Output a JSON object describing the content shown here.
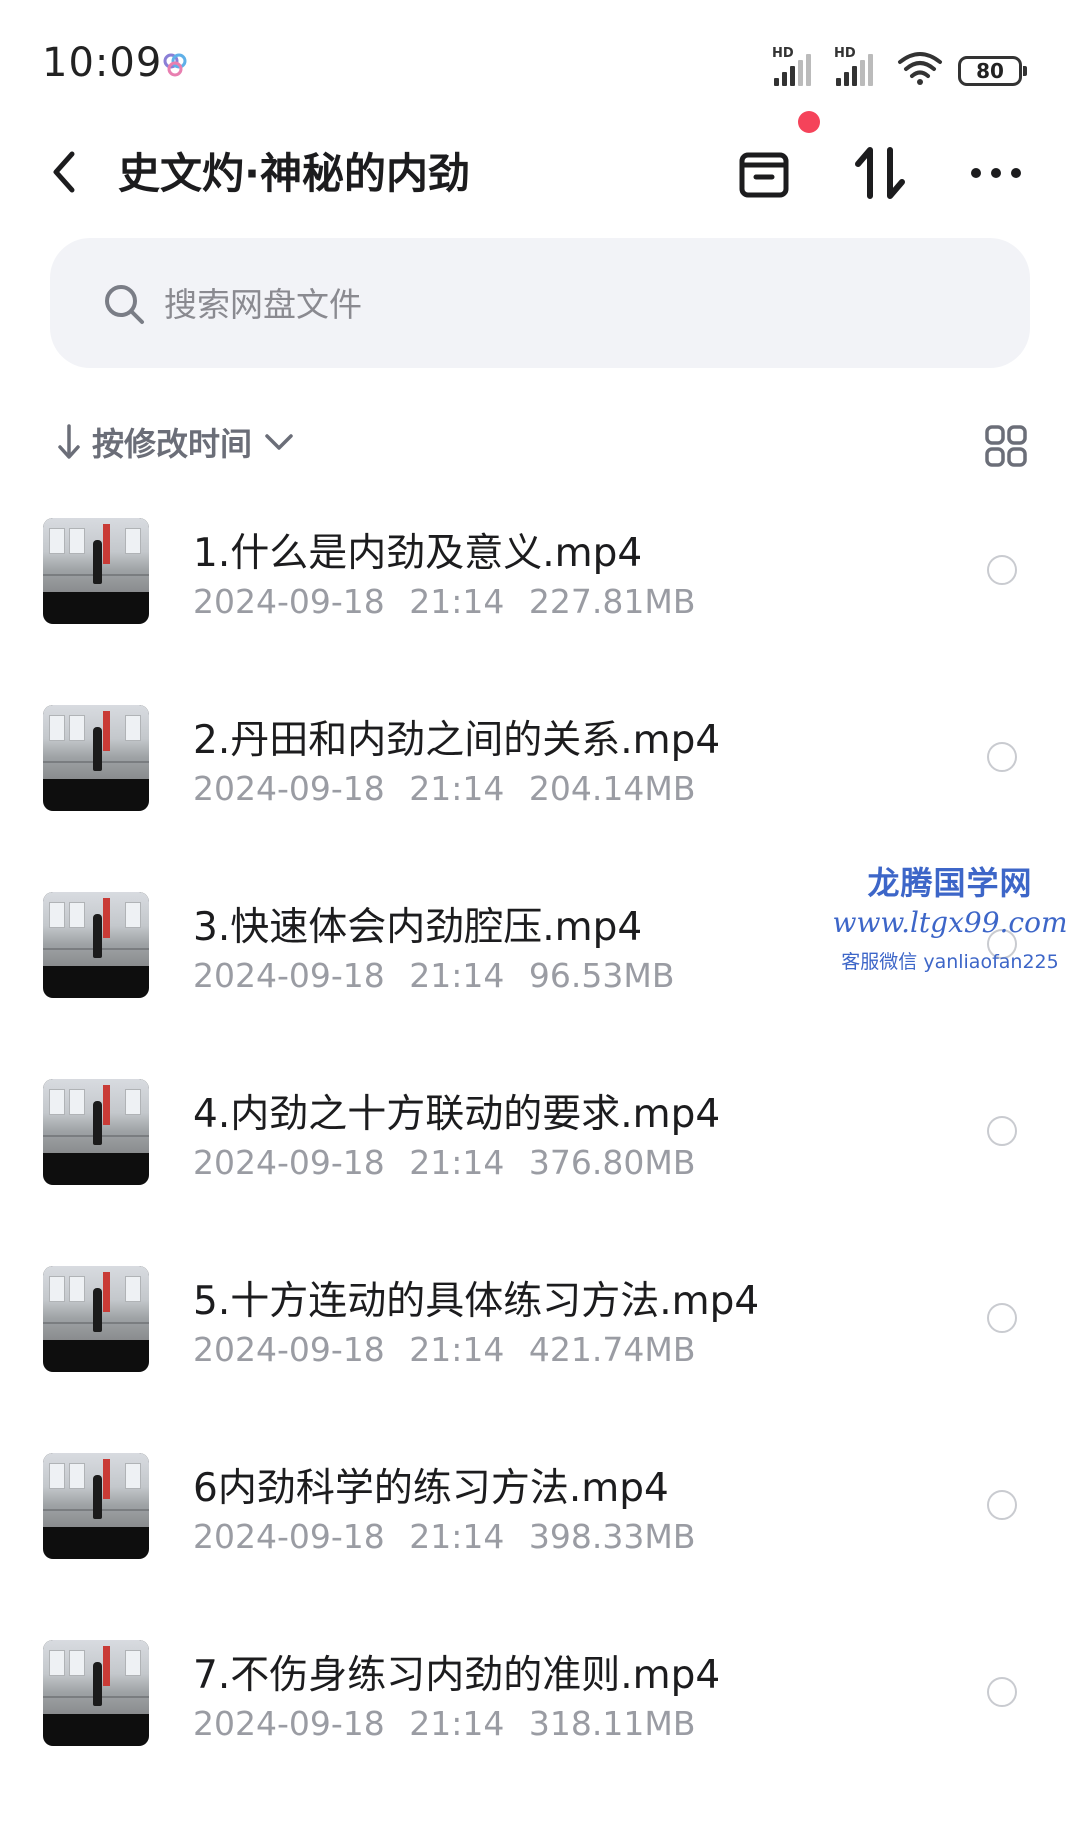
{
  "status_bar": {
    "time": "10:09",
    "signal1_label": "HD",
    "signal2_label": "HD",
    "battery": "80"
  },
  "header": {
    "title": "史文灼·神秘的内劲"
  },
  "search": {
    "placeholder": "搜索网盘文件"
  },
  "sort": {
    "label": "按修改时间"
  },
  "files": [
    {
      "name": "1.什么是内劲及意义.mp4",
      "date": "2024-09-18",
      "time": "21:14",
      "size": "227.81MB"
    },
    {
      "name": "2.丹田和内劲之间的关系.mp4",
      "date": "2024-09-18",
      "time": "21:14",
      "size": "204.14MB"
    },
    {
      "name": "3.快速体会内劲腔压.mp4",
      "date": "2024-09-18",
      "time": "21:14",
      "size": "96.53MB"
    },
    {
      "name": "4.内劲之十方联动的要求.mp4",
      "date": "2024-09-18",
      "time": "21:14",
      "size": "376.80MB"
    },
    {
      "name": "5.十方连动的具体练习方法.mp4",
      "date": "2024-09-18",
      "time": "21:14",
      "size": "421.74MB"
    },
    {
      "name": "6内劲科学的练习方法.mp4",
      "date": "2024-09-18",
      "time": "21:14",
      "size": "398.33MB"
    },
    {
      "name": "7.不伤身练习内劲的准则.mp4",
      "date": "2024-09-18",
      "time": "21:14",
      "size": "318.11MB"
    }
  ],
  "watermark": {
    "line1": "龙腾国学网",
    "line2": "www.ltgx99.com",
    "line3": "客服微信 yanliaofan225"
  },
  "icons": {
    "back": "chevron-left-icon",
    "archive": "archive-box-icon",
    "transfer": "transfer-arrows-icon",
    "more": "more-dots-icon",
    "search": "search-icon",
    "sort_arrow": "arrow-down-icon",
    "sort_chevron": "chevron-down-icon",
    "view_toggle": "grid-view-icon"
  },
  "colors": {
    "notification_dot": "#f5435a",
    "search_bg": "#f2f3f7",
    "watermark": "#3d66c8"
  }
}
